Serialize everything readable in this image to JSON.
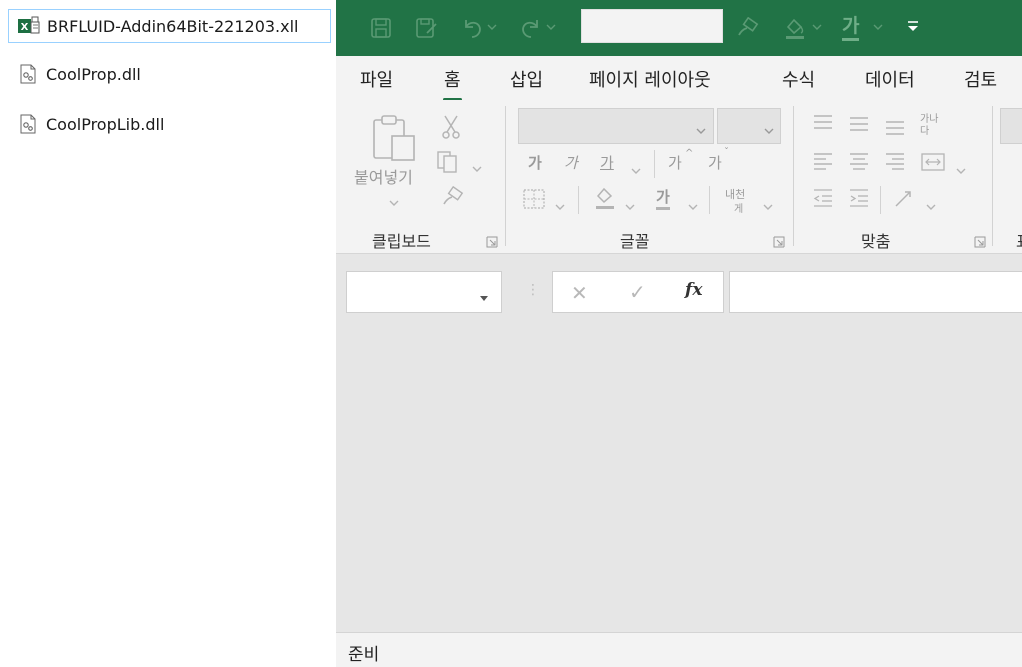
{
  "explorer": {
    "files": [
      {
        "name": "BRFLUID-Addin64Bit-221203.xll",
        "icon": "excel-addin-icon",
        "selected": true
      },
      {
        "name": "CoolProp.dll",
        "icon": "dll-file-icon",
        "selected": false
      },
      {
        "name": "CoolPropLib.dll",
        "icon": "dll-file-icon",
        "selected": false
      }
    ]
  },
  "excel": {
    "colors": {
      "title_bar": "#217346",
      "ribbon": "#f3f3f3",
      "workspace": "#e6e6e6"
    },
    "tabs": [
      "파일",
      "홈",
      "삽입",
      "페이지 레이아웃",
      "수식",
      "데이터",
      "검토"
    ],
    "active_tab": "홈",
    "ribbon": {
      "clipboard": {
        "label": "클립보드",
        "paste_label": "붙여넣기"
      },
      "font": {
        "label": "글꼴",
        "bold": "가",
        "italic": "가",
        "underline": "가",
        "grow": "가",
        "shrink": "가",
        "font_color": "가",
        "phonetic": "내천",
        "phonetic_sub": "게"
      },
      "alignment": {
        "label": "맞춤",
        "wrap": "가나",
        "wrap_sub": "다"
      },
      "next_group_label": "표"
    },
    "formula_bar": {
      "cancel": "✕",
      "enter": "✓",
      "fx": "fx"
    },
    "status": {
      "text": "준비"
    }
  }
}
